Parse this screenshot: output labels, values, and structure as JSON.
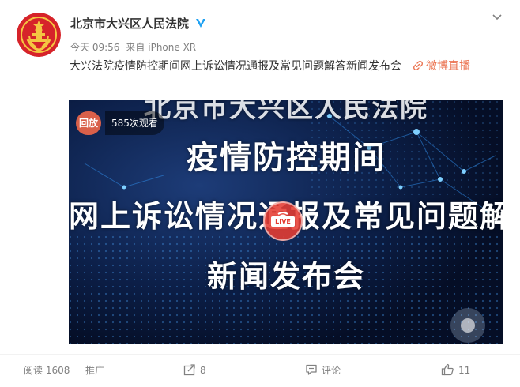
{
  "author": {
    "name": "北京市大兴区人民法院",
    "verified": true,
    "avatar_icon": "court-emblem-icon",
    "avatar_color": "#d6232a"
  },
  "meta": {
    "time": "今天 09:56",
    "source_prefix": "来自",
    "device": "iPhone XR"
  },
  "post": {
    "text": "大兴法院疫情防控期间网上诉讼情况通报及常见问题解答新闻发布会",
    "topic_label": "微博直播",
    "topic_color": "#eb7350"
  },
  "video": {
    "replay_label": "回放",
    "views_label": "585次观看",
    "live_label": "LIVE",
    "lines": [
      "北京市大兴区人民法院",
      "疫情防控期间",
      "网上诉讼情况通报及常见问题解答",
      "新闻发布会"
    ]
  },
  "footer": {
    "reads": "阅读 1608",
    "promote": "推广",
    "shares": "8",
    "comments": "评论",
    "likes": "11"
  },
  "icons": {
    "more": "chevron-down-icon",
    "share": "share-icon",
    "comment": "comment-icon",
    "like": "thumbs-up-icon",
    "topic": "link-icon"
  }
}
